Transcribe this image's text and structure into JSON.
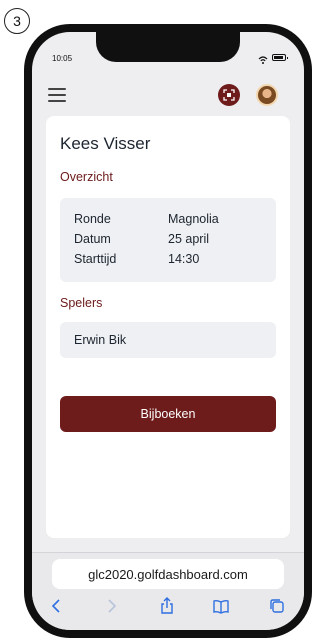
{
  "step_number": "3",
  "status_bar": {
    "time": "10:05"
  },
  "header": {
    "menu_icon": "hamburger-menu-icon",
    "scan_icon": "qr-scan-icon",
    "accent_color": "#6d1b1b"
  },
  "booking": {
    "player_name": "Kees Visser",
    "overview_label": "Overzicht",
    "details": [
      {
        "label": "Ronde",
        "value": "Magnolia"
      },
      {
        "label": "Datum",
        "value": "25 april"
      },
      {
        "label": "Starttijd",
        "value": "14:30"
      }
    ],
    "players_label": "Spelers",
    "players": [
      "Erwin Bik"
    ],
    "book_button_label": "Bijboeken"
  },
  "browser": {
    "url": "glc2020.golfdashboard.com",
    "toolbar_icons": [
      "back-icon",
      "forward-icon",
      "share-icon",
      "bookmarks-icon",
      "tabs-icon"
    ]
  }
}
